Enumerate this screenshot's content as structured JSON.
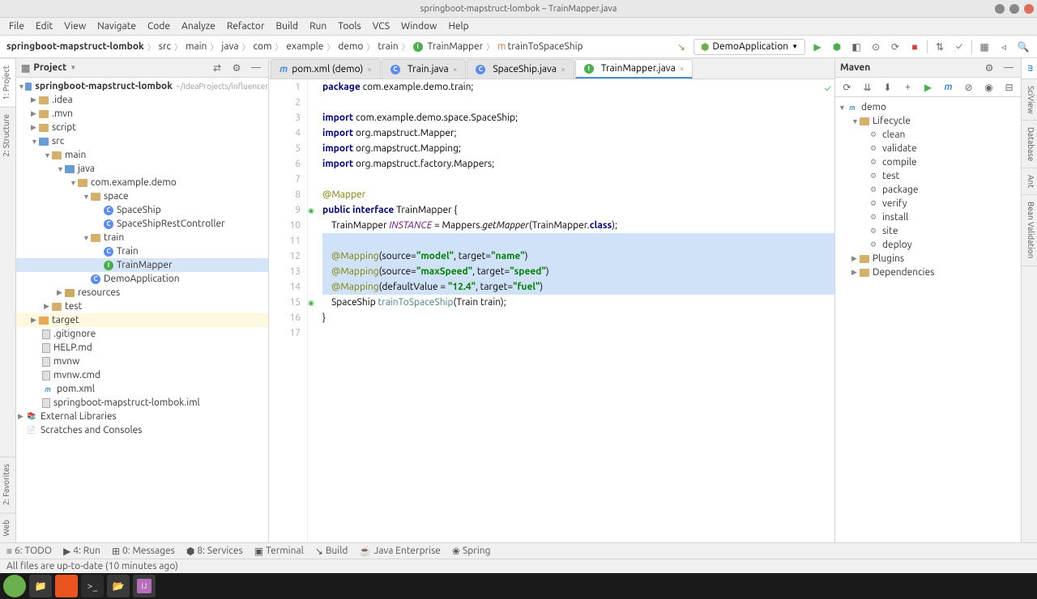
{
  "window": {
    "title": "springboot-mapstruct-lombok – TrainMapper.java"
  },
  "menu": [
    "File",
    "Edit",
    "View",
    "Navigate",
    "Code",
    "Analyze",
    "Refactor",
    "Build",
    "Run",
    "Tools",
    "VCS",
    "Window",
    "Help"
  ],
  "breadcrumb": {
    "project": "springboot-mapstruct-lombok",
    "parts": [
      "src",
      "main",
      "java",
      "com",
      "example",
      "demo",
      "train"
    ],
    "class": "TrainMapper",
    "method": "trainToSpaceShip"
  },
  "runConfig": "DemoApplication",
  "left_tabs": [
    "1: Project",
    "2: Structure",
    "2: Favorites",
    "Web"
  ],
  "right_tabs": [
    "m",
    "SciView",
    "Database",
    "Ant",
    "Bean Validation"
  ],
  "project_panel": {
    "title": "Project"
  },
  "project_tree": {
    "root": {
      "name": "springboot-mapstruct-lombok",
      "hint": "~/IdeaProjects/influencer"
    },
    "idea": ".idea",
    "mvn": ".mvn",
    "script": "script",
    "src": "src",
    "main_dir": "main",
    "java": "java",
    "pkg": "com.example.demo",
    "space": "space",
    "spaceship": "SpaceShip",
    "spaceship_rest": "SpaceShipRestController",
    "train_pkg": "train",
    "train_cls": "Train",
    "train_mapper": "TrainMapper",
    "demo_app": "DemoApplication",
    "resources": "resources",
    "test": "test",
    "target": "target",
    "gitignore": ".gitignore",
    "help": "HELP.md",
    "mvnw": "mvnw",
    "mvnwcmd": "mvnw.cmd",
    "pom": "pom.xml",
    "iml": "springboot-mapstruct-lombok.iml",
    "ext": "External Libraries",
    "scratches": "Scratches and Consoles"
  },
  "editor_tabs": [
    {
      "label": "pom.xml (demo)",
      "icon": "m"
    },
    {
      "label": "Train.java",
      "icon": "c"
    },
    {
      "label": "SpaceShip.java",
      "icon": "c"
    },
    {
      "label": "TrainMapper.java",
      "icon": "i"
    }
  ],
  "code": {
    "lines": [
      {
        "n": 1,
        "seg": [
          [
            "kw",
            "package "
          ],
          [
            "pkg",
            "com.example.demo.train"
          ],
          [
            "",
            ";"
          ]
        ]
      },
      {
        "n": 2,
        "seg": [
          [
            "",
            ""
          ]
        ]
      },
      {
        "n": 3,
        "seg": [
          [
            "kw",
            "import "
          ],
          [
            "pkg",
            "com.example.demo.space.SpaceShip"
          ],
          [
            "",
            ";"
          ]
        ]
      },
      {
        "n": 4,
        "seg": [
          [
            "kw",
            "import "
          ],
          [
            "pkg",
            "org.mapstruct."
          ],
          [
            "type",
            "Mapper"
          ],
          [
            "",
            ";"
          ]
        ]
      },
      {
        "n": 5,
        "seg": [
          [
            "kw",
            "import "
          ],
          [
            "pkg",
            "org.mapstruct."
          ],
          [
            "type",
            "Mapping"
          ],
          [
            "",
            ";"
          ]
        ]
      },
      {
        "n": 6,
        "seg": [
          [
            "kw",
            "import "
          ],
          [
            "pkg",
            "org.mapstruct.factory.Mappers"
          ],
          [
            "",
            ";"
          ]
        ]
      },
      {
        "n": 7,
        "seg": [
          [
            "",
            ""
          ]
        ]
      },
      {
        "n": 8,
        "seg": [
          [
            "ann",
            "@Mapper"
          ]
        ]
      },
      {
        "n": 9,
        "seg": [
          [
            "kw",
            "public interface "
          ],
          [
            "type",
            "TrainMapper "
          ],
          [
            "",
            "{"
          ]
        ]
      },
      {
        "n": 10,
        "seg": [
          [
            "",
            "    TrainMapper "
          ],
          [
            "field",
            "INSTANCE"
          ],
          [
            "",
            " = Mappers."
          ],
          [
            "method",
            "getMapper"
          ],
          [
            "",
            "(TrainMapper."
          ],
          [
            "kw",
            "class"
          ],
          [
            "",
            ");"
          ]
        ]
      },
      {
        "n": 11,
        "sel": true,
        "seg": [
          [
            "",
            ""
          ]
        ]
      },
      {
        "n": 12,
        "sel": true,
        "seg": [
          [
            "",
            "    "
          ],
          [
            "ann",
            "@Mapping"
          ],
          [
            "",
            "(source="
          ],
          [
            "str",
            "\"model\""
          ],
          [
            "",
            ", target="
          ],
          [
            "str",
            "\"name\""
          ],
          [
            "",
            ")"
          ]
        ]
      },
      {
        "n": 13,
        "sel": true,
        "seg": [
          [
            "",
            "    "
          ],
          [
            "ann",
            "@Mapping"
          ],
          [
            "",
            "(source="
          ],
          [
            "str",
            "\"maxSpeed\""
          ],
          [
            "",
            ", target="
          ],
          [
            "str",
            "\"speed\""
          ],
          [
            "",
            ")"
          ]
        ]
      },
      {
        "n": 14,
        "sel": true,
        "seg": [
          [
            "",
            "    "
          ],
          [
            "ann",
            "@Mapping"
          ],
          [
            "",
            "(defaultValue = "
          ],
          [
            "str",
            "\"12.4\""
          ],
          [
            "",
            ", target="
          ],
          [
            "str",
            "\"fuel\""
          ],
          [
            "",
            ")"
          ]
        ]
      },
      {
        "n": 15,
        "seg": [
          [
            "",
            "    SpaceShip "
          ],
          [
            "param",
            "trainToSpaceShip"
          ],
          [
            "",
            "(Train train);"
          ]
        ]
      },
      {
        "n": 16,
        "seg": [
          [
            "",
            "}"
          ]
        ]
      },
      {
        "n": 17,
        "seg": [
          [
            "",
            ""
          ]
        ]
      }
    ]
  },
  "maven": {
    "title": "Maven",
    "root": "demo",
    "lifecycle": "Lifecycle",
    "goals": [
      "clean",
      "validate",
      "compile",
      "test",
      "package",
      "verify",
      "install",
      "site",
      "deploy"
    ],
    "plugins": "Plugins",
    "deps": "Dependencies"
  },
  "bottom_tabs": [
    "6: TODO",
    "4: Run",
    "0: Messages",
    "8: Services",
    "Terminal",
    "Build",
    "Java Enterprise",
    "Spring"
  ],
  "status": "All files are up-to-date (10 minutes ago)"
}
